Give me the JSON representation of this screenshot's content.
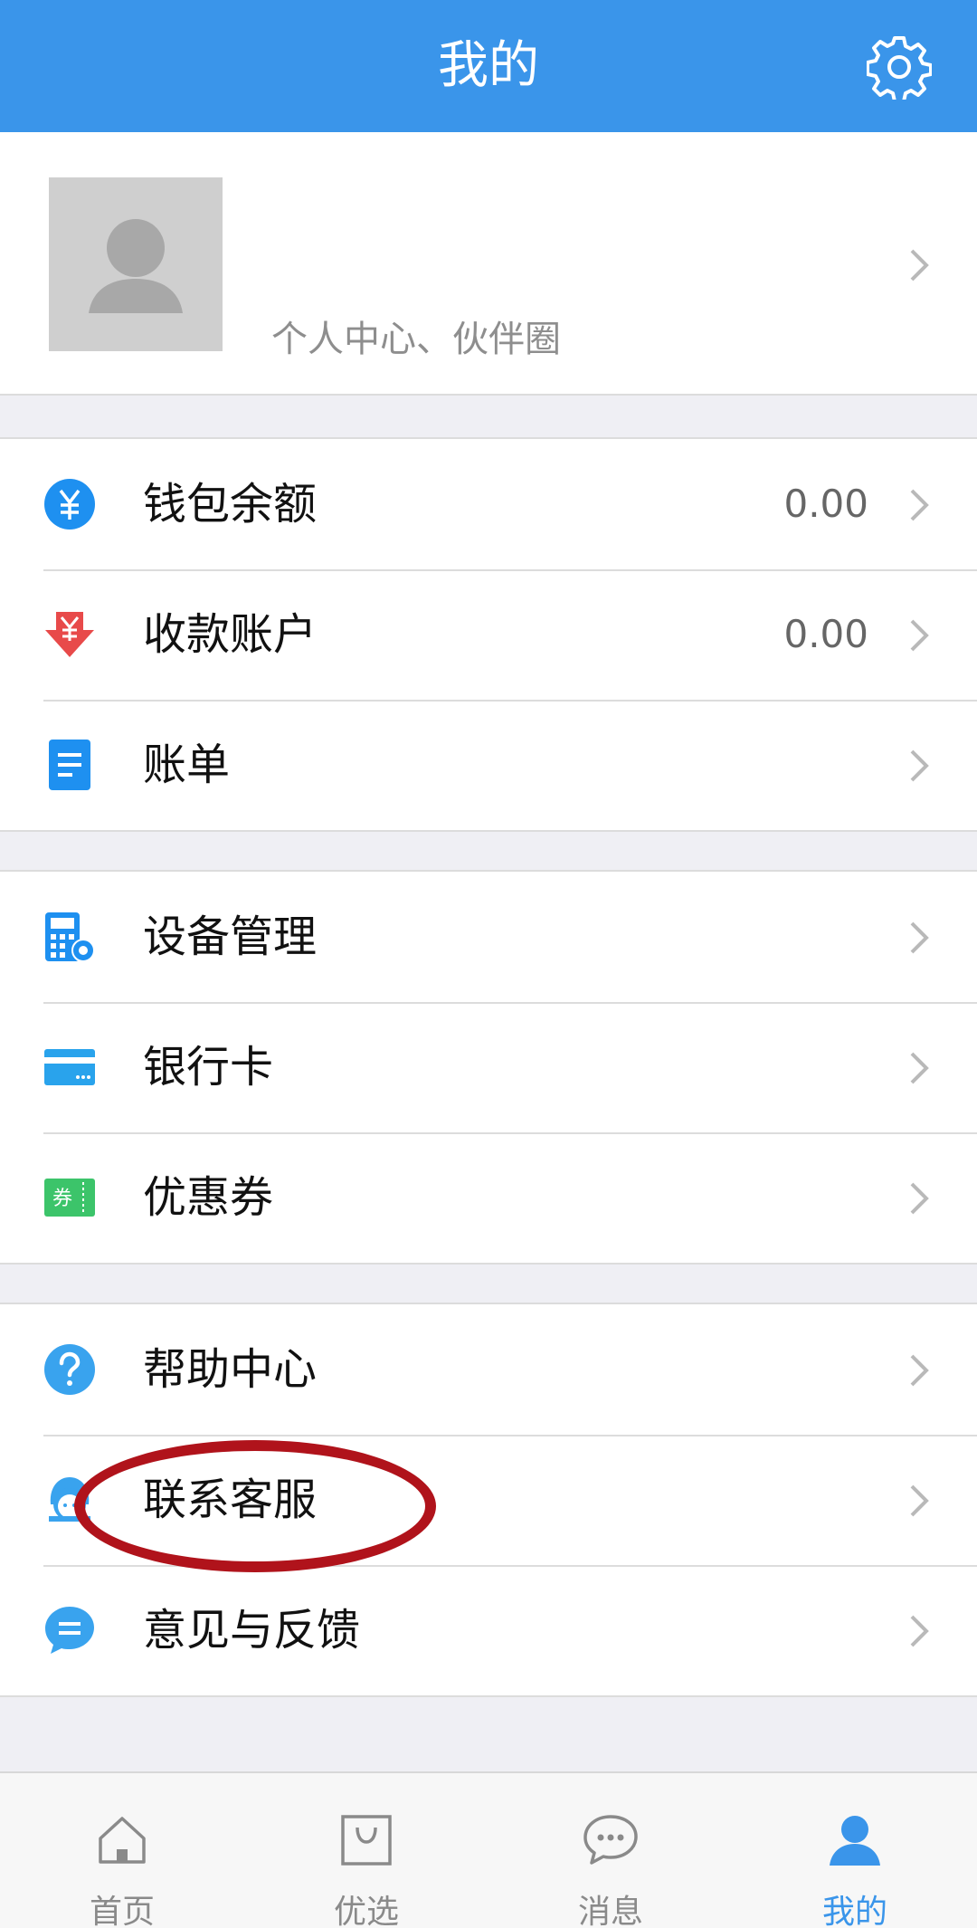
{
  "header": {
    "title": "我的",
    "settings_icon": "gear-icon"
  },
  "profile": {
    "subtitle": "个人中心、伙伴圈",
    "avatar_icon": "person-silhouette-icon"
  },
  "groups": [
    {
      "items": [
        {
          "label": "钱包余额",
          "value": "0.00",
          "icon": "yuan-circle-icon",
          "color": "#1e90f0"
        },
        {
          "label": "收款账户",
          "value": "0.00",
          "icon": "yuan-download-icon",
          "color": "#e84a4a"
        },
        {
          "label": "账单",
          "icon": "bill-document-icon",
          "color": "#1e90f0"
        }
      ]
    },
    {
      "items": [
        {
          "label": "设备管理",
          "icon": "device-settings-icon",
          "color": "#1e90f0"
        },
        {
          "label": "银行卡",
          "icon": "bank-card-icon",
          "color": "#29a3ec"
        },
        {
          "label": "优惠券",
          "icon": "coupon-icon",
          "color": "#3cc46a",
          "icon_text": "券"
        }
      ]
    },
    {
      "items": [
        {
          "label": "帮助中心",
          "icon": "question-circle-icon",
          "color": "#39a3ee"
        },
        {
          "label": "联系客服",
          "icon": "customer-service-icon",
          "color": "#39a3ee"
        },
        {
          "label": "意见与反馈",
          "icon": "feedback-bubble-icon",
          "color": "#39a3ee"
        }
      ]
    }
  ],
  "tabbar": {
    "tabs": [
      {
        "label": "首页",
        "icon": "home-icon"
      },
      {
        "label": "优选",
        "icon": "shopping-bag-icon"
      },
      {
        "label": "消息",
        "icon": "chat-bubble-icon"
      },
      {
        "label": "我的",
        "icon": "person-icon",
        "active": true
      }
    ]
  },
  "colors": {
    "accent": "#3a95ea",
    "annotation": "#b0131b"
  }
}
